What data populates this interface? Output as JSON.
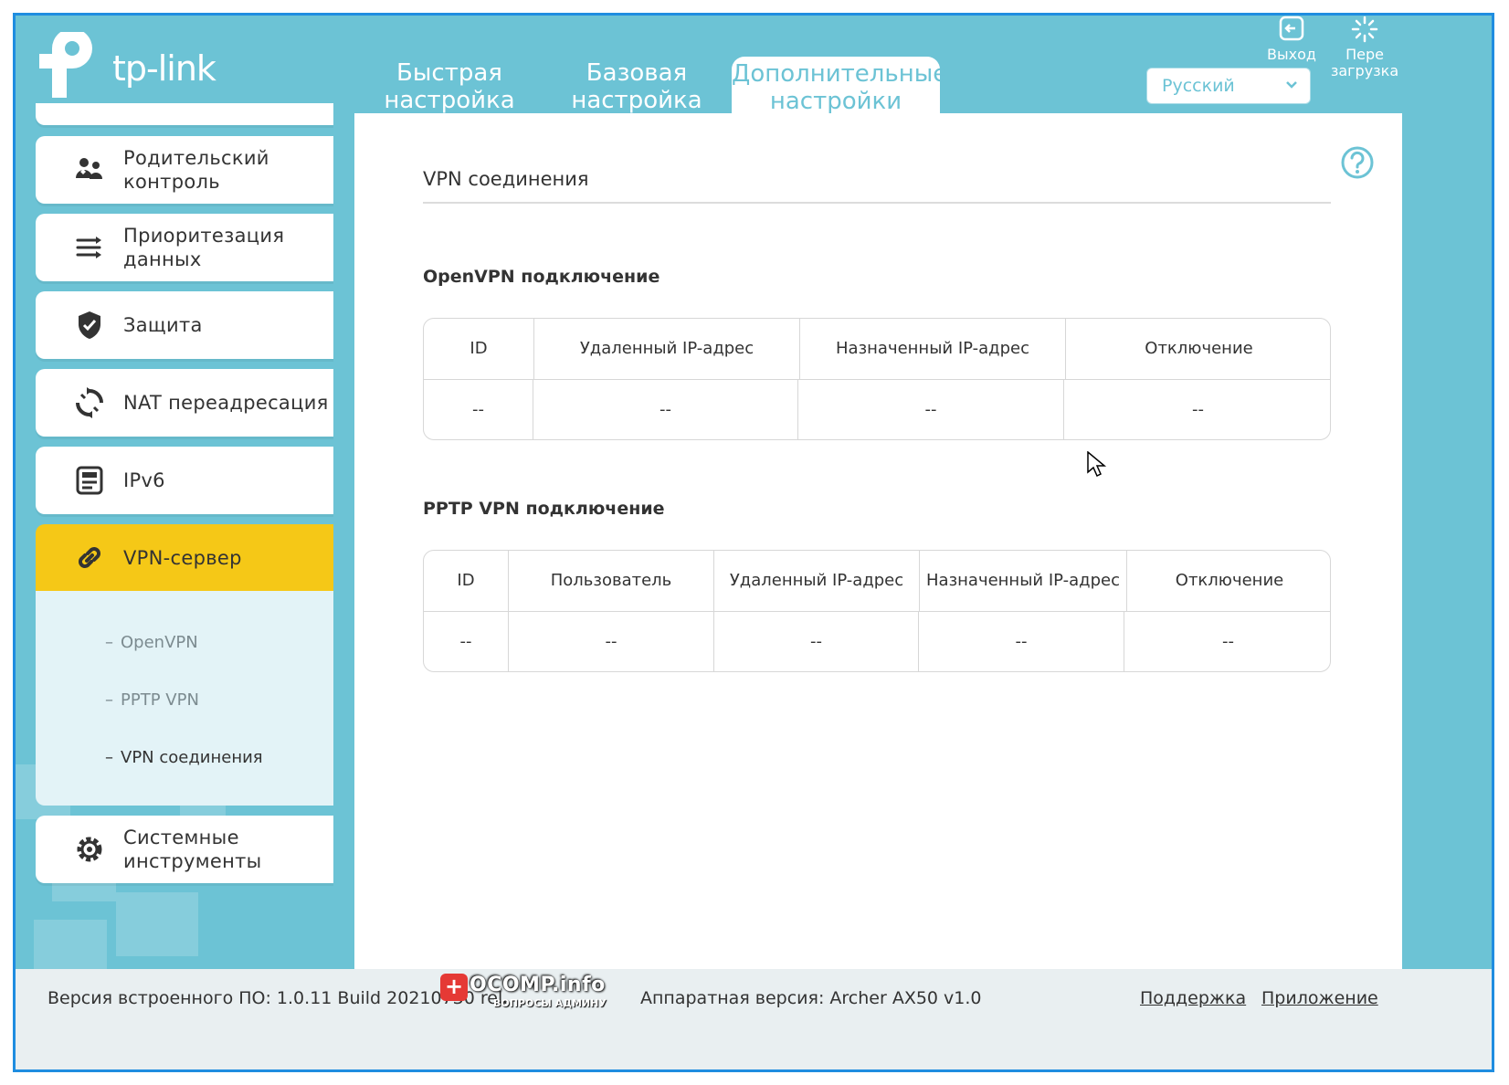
{
  "brand": {
    "name": "tp-link"
  },
  "top_nav": {
    "tabs": [
      {
        "line1": "Быстрая",
        "line2": "настройка"
      },
      {
        "line1": "Базовая",
        "line2": "настройка"
      },
      {
        "line1": "Дополнительные",
        "line2": "настройки"
      }
    ],
    "language": "Русский",
    "logout_label": "Выход",
    "reboot_line1": "Пере",
    "reboot_line2": "загрузка"
  },
  "sidebar": {
    "items": [
      {
        "line1": "Родительский",
        "line2": "контроль",
        "icon": "parental-control-icon"
      },
      {
        "line1": "Приоритезация",
        "line2": "данных",
        "icon": "qos-icon"
      },
      {
        "line1": "Защита",
        "line2": "",
        "icon": "shield-icon"
      },
      {
        "line1": "NAT переадресация",
        "line2": "",
        "icon": "nat-forwarding-icon"
      },
      {
        "line1": "IPv6",
        "line2": "",
        "icon": "ipv6-icon"
      },
      {
        "line1": "VPN-сервер",
        "line2": "",
        "icon": "link-icon"
      },
      {
        "line1": "Системные",
        "line2": "инструменты",
        "icon": "gear-icon"
      }
    ],
    "submenu": [
      "OpenVPN",
      "PPTP VPN",
      "VPN соединения"
    ],
    "submenu_dash": "–"
  },
  "content": {
    "page_title": "VPN соединения",
    "openvpn": {
      "title": "OpenVPN подключение",
      "columns": [
        "ID",
        "Удаленный IP-адрес",
        "Назначенный IP-адрес",
        "Отключение"
      ],
      "row": [
        "--",
        "--",
        "--",
        "--"
      ]
    },
    "pptp": {
      "title": "PPTP VPN подключение",
      "columns": [
        "ID",
        "Пользователь",
        "Удаленный IP-адрес",
        "Назначенный IP-адрес",
        "Отключение"
      ],
      "row": [
        "--",
        "--",
        "--",
        "--",
        "--"
      ]
    }
  },
  "footer": {
    "firmware": "Версия встроенного ПО: 1.0.11 Build 20210730 rel.",
    "hardware": "Аппаратная версия: Archer AX50 v1.0",
    "support": "Поддержка",
    "app": "Приложение"
  },
  "watermark": {
    "text": "OCOMP.info",
    "sub": "ВОПРОСЫ АДМИНУ",
    "badge": "+"
  },
  "colors": {
    "frame": "#6cc3d5",
    "active_menu": "#f5c817",
    "border": "#1f8de0"
  }
}
